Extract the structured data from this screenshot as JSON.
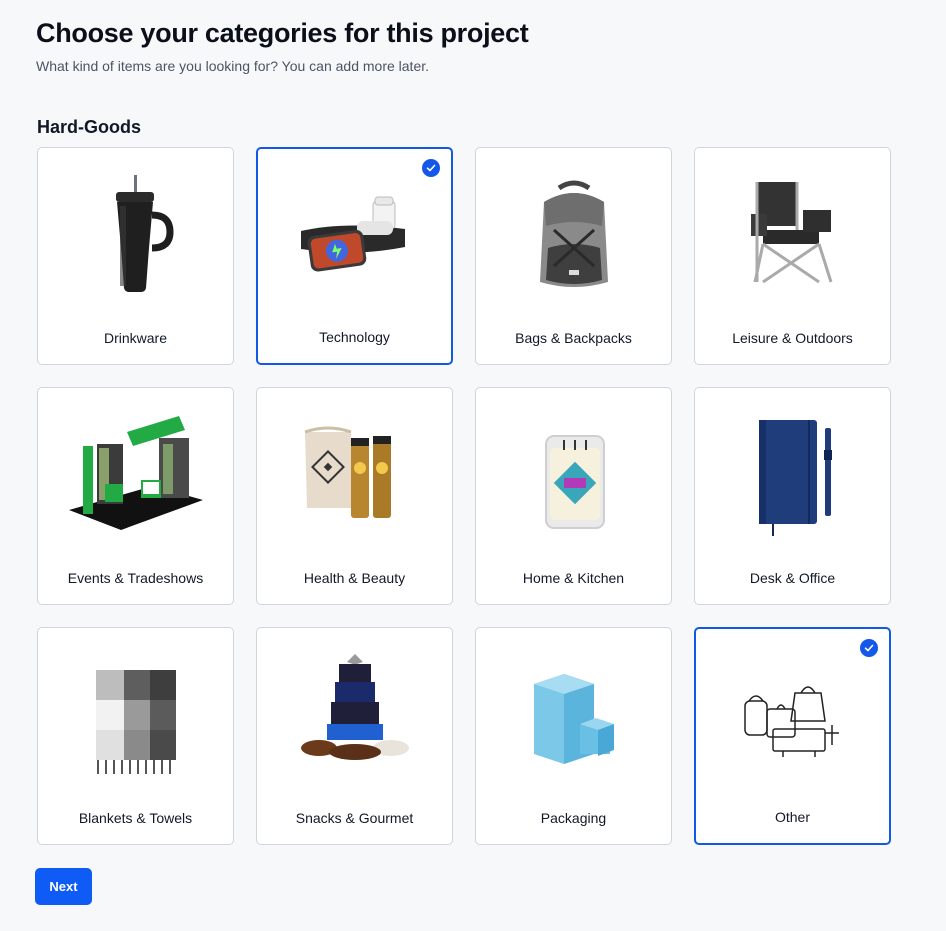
{
  "header": {
    "title": "Choose your categories for this project",
    "subtitle": "What kind of items are you looking for? You can add more later."
  },
  "section": {
    "title": "Hard-Goods"
  },
  "categories": [
    {
      "label": "Drinkware",
      "selected": false,
      "icon": "tumbler-icon"
    },
    {
      "label": "Technology",
      "selected": true,
      "icon": "wireless-charger-icon"
    },
    {
      "label": "Bags & Backpacks",
      "selected": false,
      "icon": "backpack-icon"
    },
    {
      "label": "Leisure & Outdoors",
      "selected": false,
      "icon": "folding-chair-icon"
    },
    {
      "label": "Events & Tradeshows",
      "selected": false,
      "icon": "tradeshow-booth-icon"
    },
    {
      "label": "Health & Beauty",
      "selected": false,
      "icon": "beauty-kit-icon"
    },
    {
      "label": "Home & Kitchen",
      "selected": false,
      "icon": "candle-icon"
    },
    {
      "label": "Desk & Office",
      "selected": false,
      "icon": "notebook-icon"
    },
    {
      "label": "Blankets & Towels",
      "selected": false,
      "icon": "blanket-icon"
    },
    {
      "label": "Snacks & Gourmet",
      "selected": false,
      "icon": "gift-tower-icon"
    },
    {
      "label": "Packaging",
      "selected": false,
      "icon": "gift-box-icon"
    },
    {
      "label": "Other",
      "selected": true,
      "icon": "assorted-items-icon"
    }
  ],
  "actions": {
    "next_label": "Next"
  },
  "colors": {
    "accent": "#1358e8",
    "button": "#0f5bf5",
    "background": "#f7f8fa"
  }
}
